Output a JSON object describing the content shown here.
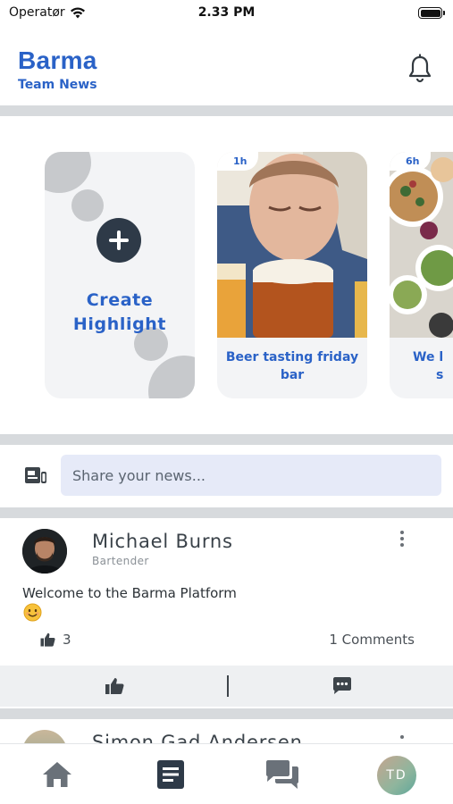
{
  "status_bar": {
    "carrier": "Operatør",
    "time": "2.33 PM"
  },
  "header": {
    "title": "Barma",
    "subtitle": "Team News"
  },
  "highlights": {
    "create_label_line1": "Create",
    "create_label_line2": "Highlight",
    "stories": [
      {
        "time": "1h",
        "title_line1": "Beer tasting friday",
        "title_line2": "bar"
      },
      {
        "time": "6h",
        "title_line1": "We l",
        "title_line2": "s"
      }
    ]
  },
  "share": {
    "placeholder": "Share your news..."
  },
  "post": {
    "author": "Michael Burns",
    "role": "Bartender",
    "text": "Welcome to the Barma Platform",
    "likes": "3",
    "comments": "1 Comments"
  },
  "next_post": {
    "author": "Simon Gad Andersen"
  },
  "tabbar": {
    "avatar_initials": "TD"
  },
  "colors": {
    "brand": "#2a62c7",
    "input_bg": "#e6eaf8",
    "dark_icon": "#2e3a48"
  }
}
